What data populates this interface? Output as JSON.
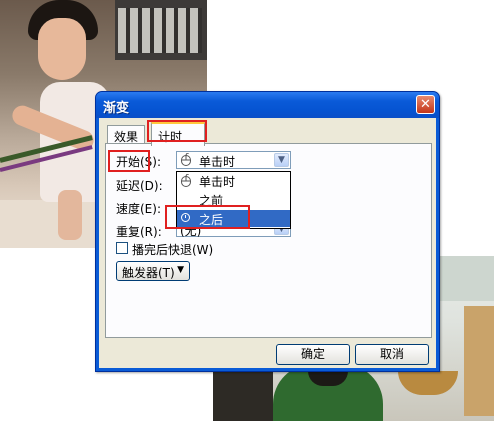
{
  "dialog": {
    "title": "渐变",
    "close_glyph": "✕",
    "tabs": [
      {
        "label": "效果"
      },
      {
        "label": "计时"
      }
    ],
    "start_label": "开始(S):",
    "start_value": "单击时",
    "delay_label": "延迟(D):",
    "speed_label": "速度(E):",
    "repeat_label": "重复(R):",
    "repeat_value": "(无)",
    "start_options": [
      {
        "label": "单击时",
        "icon": "mouse-icon"
      },
      {
        "label": "之前",
        "icon": "none"
      },
      {
        "label": "之后",
        "icon": "clock-icon",
        "selected": true
      }
    ],
    "rewind_label": "播完后快退(W)",
    "rewind_checked": false,
    "trigger_label": "触发器(T)",
    "trigger_glyph": "▼",
    "ok_label": "确定",
    "cancel_label": "取消"
  },
  "colors": {
    "titlebar": "#0a5ad8",
    "highlight": "#e02020",
    "selection": "#316ac5"
  }
}
